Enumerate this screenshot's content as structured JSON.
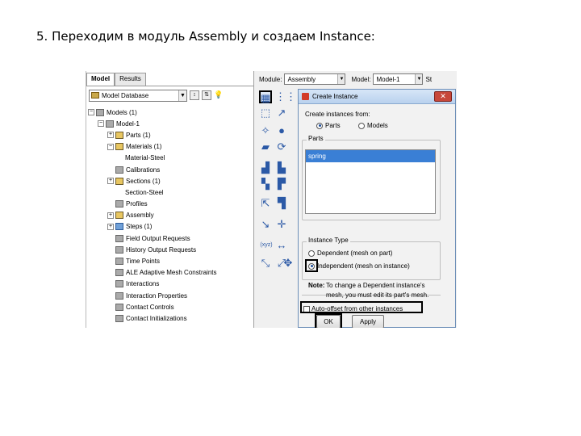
{
  "slide": {
    "title": "5. Переходим в модуль Assembly и создаем Instance:"
  },
  "tabs": [
    "Model",
    "Results"
  ],
  "database_select": "Model Database",
  "toolbar_glyphs": [
    "↕",
    "⇅",
    "💡"
  ],
  "tree": [
    {
      "label": "Models (1)",
      "indent": 0,
      "exp": "-",
      "icon": "gray"
    },
    {
      "label": "Model-1",
      "indent": 1,
      "exp": "-",
      "icon": "gray"
    },
    {
      "label": "Parts (1)",
      "indent": 2,
      "exp": "+",
      "icon": "yellow"
    },
    {
      "label": "Materials (1)",
      "indent": 2,
      "exp": "-",
      "icon": "yellow"
    },
    {
      "label": "Material-Steel",
      "indent": 3,
      "exp": "",
      "icon": ""
    },
    {
      "label": "Calibrations",
      "indent": 2,
      "exp": "",
      "icon": "gray"
    },
    {
      "label": "Sections (1)",
      "indent": 2,
      "exp": "+",
      "icon": "yellow"
    },
    {
      "label": "Section-Steel",
      "indent": 3,
      "exp": "",
      "icon": ""
    },
    {
      "label": "Profiles",
      "indent": 2,
      "exp": "",
      "icon": "gray"
    },
    {
      "label": "Assembly",
      "indent": 2,
      "exp": "+",
      "icon": "yellow"
    },
    {
      "label": "Steps (1)",
      "indent": 2,
      "exp": "+",
      "icon": "blue"
    },
    {
      "label": "Field Output Requests",
      "indent": 2,
      "exp": "",
      "icon": "gray"
    },
    {
      "label": "History Output Requests",
      "indent": 2,
      "exp": "",
      "icon": "gray"
    },
    {
      "label": "Time Points",
      "indent": 2,
      "exp": "",
      "icon": "gray"
    },
    {
      "label": "ALE Adaptive Mesh Constraints",
      "indent": 2,
      "exp": "",
      "icon": "gray"
    },
    {
      "label": "Interactions",
      "indent": 2,
      "exp": "",
      "icon": "gray"
    },
    {
      "label": "Interaction Properties",
      "indent": 2,
      "exp": "",
      "icon": "gray"
    },
    {
      "label": "Contact Controls",
      "indent": 2,
      "exp": "",
      "icon": "gray"
    },
    {
      "label": "Contact Initializations",
      "indent": 2,
      "exp": "",
      "icon": "gray"
    }
  ],
  "module_bar": {
    "module_label": "Module:",
    "module_value": "Assembly",
    "model_label": "Model:",
    "model_value": "Model-1",
    "step_label": "St"
  },
  "tools": [
    "▦",
    "⋮⋮",
    "⬚",
    "↗",
    "✧",
    "●",
    "▰",
    "⟳",
    "▟",
    "▙",
    "▚",
    "▛",
    "⇱",
    "▜",
    "↘",
    "✛",
    "(xyz)",
    "↔",
    "⤡",
    "⤢",
    "✥"
  ],
  "dialog": {
    "title": "Create Instance",
    "close": "✕",
    "create_from_label": "Create instances from:",
    "opt_parts": "Parts",
    "opt_models": "Models",
    "parts_group": "Parts",
    "parts": [
      "spring"
    ],
    "instance_type_group": "Instance Type",
    "opt_dependent": "Dependent (mesh on part)",
    "opt_independent": "Independent (mesh on instance)",
    "note_label": "Note:",
    "note_line1": "To change a Dependent instance's",
    "note_line2": "mesh, you must edit its part's mesh.",
    "auto_offset": "Auto-offset from other instances",
    "ok": "OK",
    "apply": "Apply"
  }
}
